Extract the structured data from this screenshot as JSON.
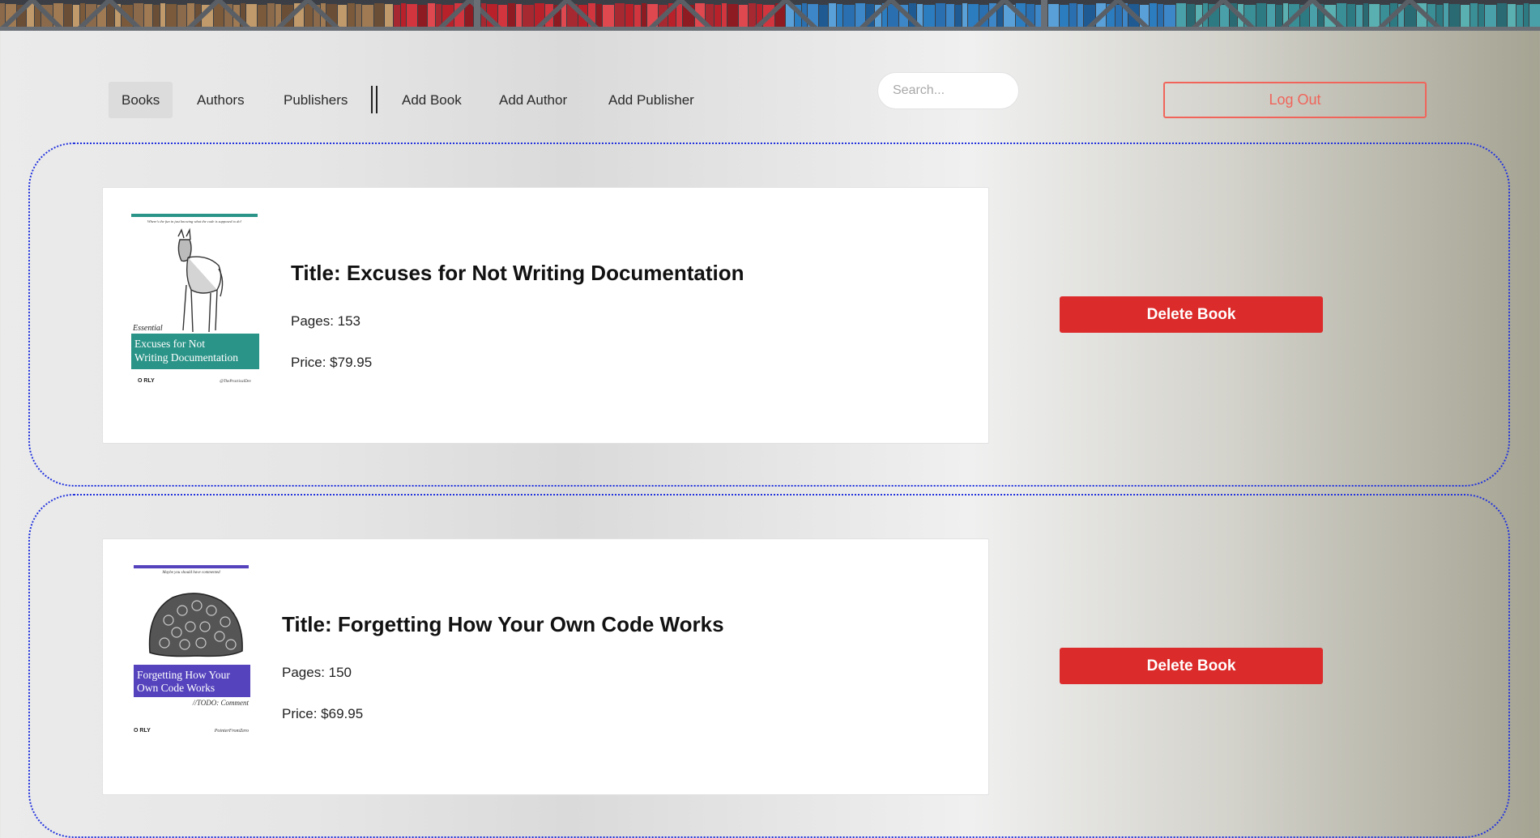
{
  "nav": {
    "items": [
      {
        "label": "Books",
        "active": true
      },
      {
        "label": "Authors",
        "active": false
      },
      {
        "label": "Publishers",
        "active": false
      },
      {
        "label": "Add Book",
        "active": false
      },
      {
        "label": "Add Author",
        "active": false
      },
      {
        "label": "Add Publisher",
        "active": false
      }
    ]
  },
  "search": {
    "placeholder": "Search...",
    "value": ""
  },
  "logout_label": "Log Out",
  "books": [
    {
      "title": "Title: Excuses for Not Writing Documentation",
      "pages": "Pages: 153",
      "price": "Price: $79.95",
      "delete_label": "Delete Book",
      "cover": {
        "tagline": "Where's the fun in just knowing what the code is supposed to do!",
        "prefix": "Essential",
        "title_line1": "Excuses for Not",
        "title_line2": "Writing Documentation",
        "publisher": "O RLY",
        "author": "@ThePracticalDev",
        "accent_color": "#2b9488",
        "animal": "donkey-icon"
      }
    },
    {
      "title": "Title: Forgetting How Your Own Code Works",
      "pages": "Pages: 150",
      "price": "Price: $69.95",
      "delete_label": "Delete Book",
      "cover": {
        "tagline": "Maybe you should have commented",
        "title_line1": "Forgetting How Your",
        "title_line2": "Own Code Works",
        "subtitle": "//TODO: Comment",
        "publisher": "O RLY",
        "author": "PointerFromZero",
        "accent_color": "#5443bd",
        "animal": "coral-icon"
      }
    }
  ],
  "colors": {
    "delete": "#dc2b2b",
    "logout": "#f0645a",
    "panel_border": "#2233dd"
  }
}
